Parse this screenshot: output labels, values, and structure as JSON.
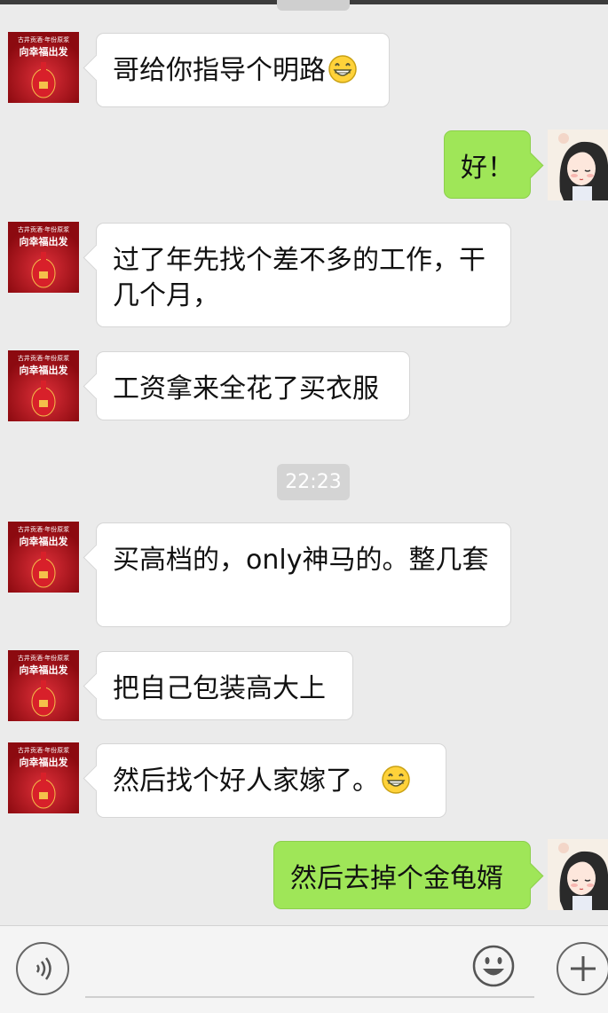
{
  "messages": [
    {
      "side": "left",
      "text": "哥给你指导个明路",
      "emoji": "grin"
    },
    {
      "side": "right",
      "text": "好！"
    },
    {
      "side": "left",
      "text": "过了年先找个差不多的工作，干几个月，"
    },
    {
      "side": "left",
      "text": "工资拿来全花了买衣服"
    },
    {
      "side": "left",
      "text": "买高档的，only神马的。整几套"
    },
    {
      "side": "left",
      "text": "把自己包装高大上"
    },
    {
      "side": "left",
      "text": "然后找个好人家嫁了。",
      "emoji": "grin"
    },
    {
      "side": "right",
      "text": "然后去掉个金龟婿"
    }
  ],
  "timestamp": "22:23",
  "avatar_left": {
    "line1": "古井贡酒·年份原浆",
    "line2": "向幸福出发"
  },
  "colors": {
    "bg": "#ebebeb",
    "outgoing": "#9fe658",
    "incoming": "#ffffff"
  },
  "icons": {
    "voice": "voice-icon",
    "emoji": "emoji-icon",
    "plus": "plus-icon"
  }
}
